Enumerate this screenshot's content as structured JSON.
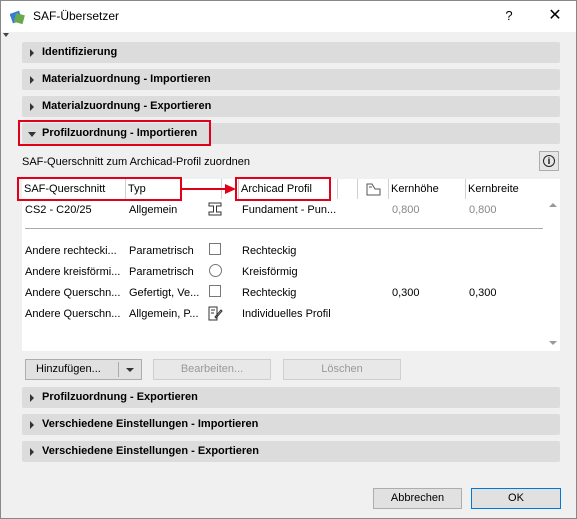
{
  "window": {
    "title": "SAF-Übersetzer",
    "help_label": "?",
    "close_label": "✕"
  },
  "sections_top": [
    {
      "label": "Identifizierung"
    },
    {
      "label": "Materialzuordnung - Importieren"
    },
    {
      "label": "Materialzuordnung - Exportieren"
    },
    {
      "label": "Profilzuordnung - Importieren",
      "expanded": true
    }
  ],
  "panel": {
    "description": "SAF-Querschnitt zum Archicad-Profil zuordnen",
    "info_icon": "i"
  },
  "table": {
    "headers": {
      "saf": "SAF-Querschnitt",
      "typ": "Typ",
      "profile": "Archicad Profil",
      "icon": "profile-icon",
      "core_height": "Kernhöhe",
      "core_width": "Kernbreite"
    },
    "rows": [
      {
        "saf": "CS2 - C20/25",
        "typ": "Allgemein",
        "icon": "i-beam-icon",
        "profile": "Fundament - Pun...",
        "core_height": "0,800",
        "core_width": "0,800"
      },
      {
        "saf": "Andere rechtecki...",
        "typ": "Parametrisch",
        "icon": "square-icon",
        "profile": "Rechteckig",
        "core_height": "",
        "core_width": ""
      },
      {
        "saf": "Andere kreisförmi...",
        "typ": "Parametrisch",
        "icon": "circle-icon",
        "profile": "Kreisförmig",
        "core_height": "",
        "core_width": ""
      },
      {
        "saf": "Andere Querschn...",
        "typ": "Gefertigt, Ve...",
        "icon": "square-icon",
        "profile": "Rechteckig",
        "core_height": "0,300",
        "core_width": "0,300"
      },
      {
        "saf": "Andere Querschn...",
        "typ": "Allgemein, P...",
        "icon": "custom-profile-icon",
        "profile": "Individuelles Profil",
        "core_height": "",
        "core_width": ""
      }
    ]
  },
  "buttons": {
    "add": "Hinzufügen...",
    "edit": "Bearbeiten...",
    "delete": "Löschen",
    "cancel": "Abbrechen",
    "ok": "OK"
  },
  "sections_bottom": [
    {
      "label": "Profilzuordnung - Exportieren"
    },
    {
      "label": "Verschiedene Einstellungen - Importieren"
    },
    {
      "label": "Verschiedene Einstellungen - Exportieren"
    }
  ],
  "colors": {
    "highlight": "#e1001a",
    "dialog_bg": "#f0f0f0",
    "section_bg": "#dcdcdc",
    "ok_border": "#0078d7"
  }
}
